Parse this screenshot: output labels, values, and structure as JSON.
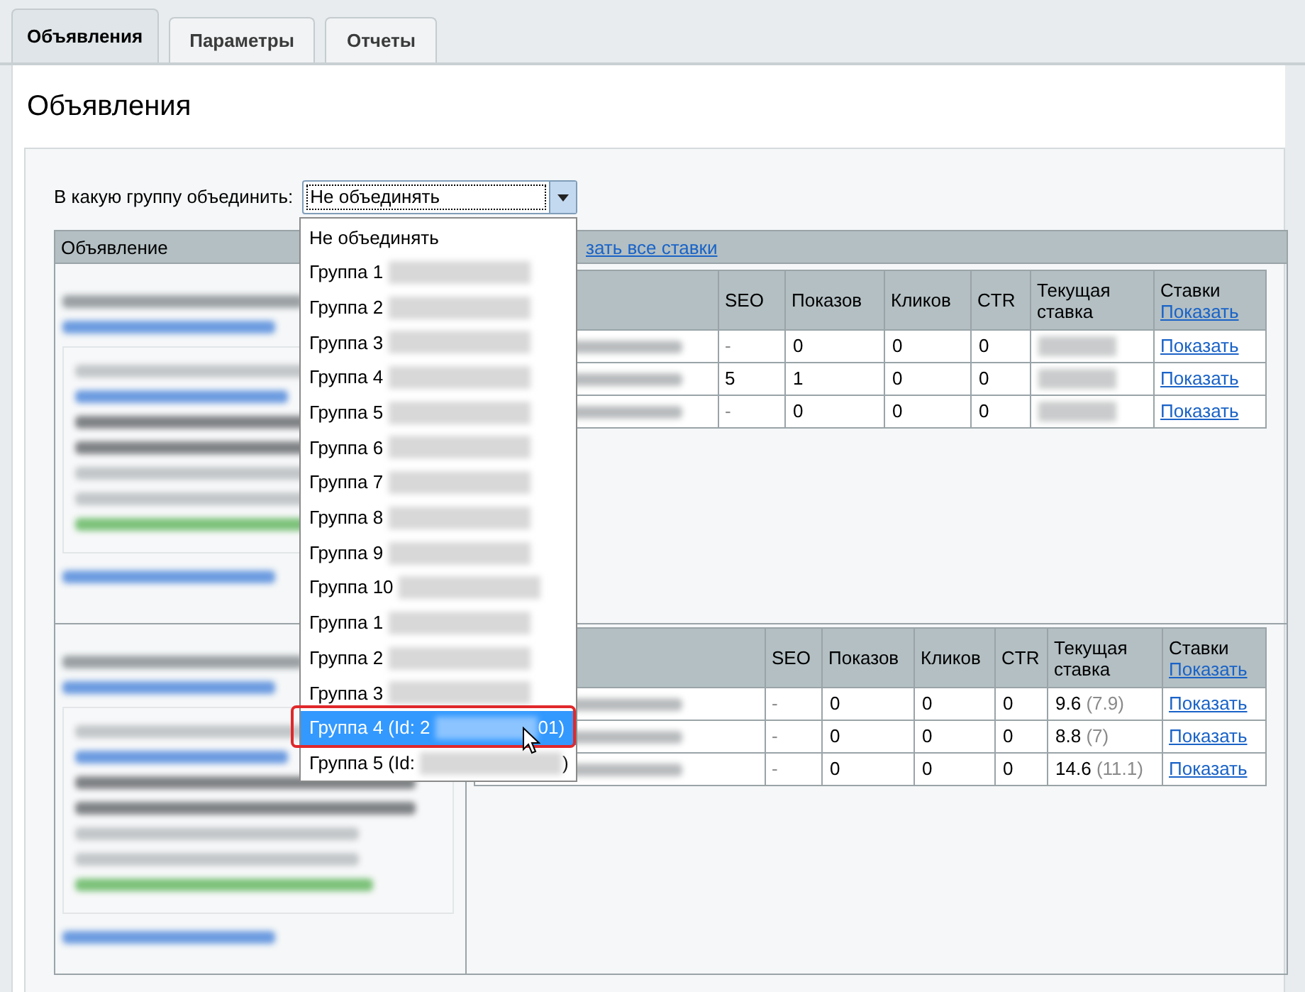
{
  "tabs": [
    {
      "label": "Объявления",
      "selected": true
    },
    {
      "label": "Параметры",
      "selected": false
    },
    {
      "label": "Отчеты",
      "selected": false
    }
  ],
  "heading": "Объявления",
  "merge": {
    "label": "В какую группу объединить:",
    "value": "Не объединять",
    "expanded": true
  },
  "dropdown": {
    "items": [
      {
        "label": "Не объединять",
        "blurred": false,
        "selected": false
      },
      {
        "label": "Группа 1",
        "blurred": true,
        "selected": false
      },
      {
        "label": "Группа 2",
        "blurred": true,
        "selected": false
      },
      {
        "label": "Группа 3",
        "blurred": true,
        "selected": false
      },
      {
        "label": "Группа 4",
        "blurred": true,
        "selected": false
      },
      {
        "label": "Группа 5",
        "blurred": true,
        "selected": false
      },
      {
        "label": "Группа 6",
        "blurred": true,
        "selected": false
      },
      {
        "label": "Группа 7",
        "blurred": true,
        "selected": false
      },
      {
        "label": "Группа 8",
        "blurred": true,
        "selected": false
      },
      {
        "label": "Группа 9",
        "blurred": true,
        "selected": false
      },
      {
        "label": "Группа 10",
        "blurred": true,
        "selected": false
      },
      {
        "label": "Группа 1",
        "blurred": true,
        "selected": false
      },
      {
        "label": "Группа 2",
        "blurred": true,
        "selected": false
      },
      {
        "label": "Группа 3",
        "blurred": true,
        "selected": false
      },
      {
        "label": "Группа 4 (Id: 2",
        "blurred": true,
        "after": "01)",
        "selected": true
      },
      {
        "label": "Группа 5 (Id:",
        "blurred": true,
        "after": ")",
        "selected": false
      }
    ]
  },
  "ads_table": {
    "column": "Объявление",
    "show_all_link": "зать все ставки",
    "ads": [
      {
        "lines": [
          {
            "kind": "title"
          },
          {
            "kind": "link"
          }
        ],
        "box_lines": [
          {
            "kind": "note"
          },
          {
            "kind": "link"
          },
          {
            "kind": "text"
          },
          {
            "kind": "text"
          },
          {
            "kind": "note"
          },
          {
            "kind": "note"
          },
          {
            "kind": "url"
          }
        ],
        "footer_lines": [
          {
            "kind": "link"
          }
        ],
        "columns": [
          "SEO",
          "Показов",
          "Кликов",
          "CTR",
          "Текущая ставка",
          "Ставки"
        ],
        "header_link": "Показать",
        "rows": [
          {
            "seo": "-",
            "seo_muted": true,
            "shows": "0",
            "clicks": "0",
            "ctr": "0",
            "bid_blurred": true,
            "link": "Показать"
          },
          {
            "seo": "5",
            "seo_muted": false,
            "shows": "1",
            "clicks": "0",
            "ctr": "0",
            "bid_blurred": true,
            "link": "Показать"
          },
          {
            "seo": "-",
            "seo_muted": true,
            "shows": "0",
            "clicks": "0",
            "ctr": "0",
            "bid_blurred": true,
            "link": "Показать"
          }
        ]
      },
      {
        "lines": [
          {
            "kind": "title"
          },
          {
            "kind": "link"
          }
        ],
        "box_lines": [
          {
            "kind": "note"
          },
          {
            "kind": "link"
          },
          {
            "kind": "text"
          },
          {
            "kind": "text"
          },
          {
            "kind": "note"
          },
          {
            "kind": "note"
          },
          {
            "kind": "url"
          }
        ],
        "footer_lines": [
          {
            "kind": "link"
          }
        ],
        "columns": [
          "SEO",
          "Показов",
          "Кликов",
          "CTR",
          "Текущая ставка",
          "Ставки"
        ],
        "header_link": "Показать",
        "rows": [
          {
            "seo": "-",
            "seo_muted": true,
            "shows": "0",
            "clicks": "0",
            "ctr": "0",
            "bid_blurred": false,
            "bid": "9.6",
            "bid_prev": "(7.9)",
            "link": "Показать"
          },
          {
            "seo": "-",
            "seo_muted": true,
            "shows": "0",
            "clicks": "0",
            "ctr": "0",
            "bid_blurred": false,
            "bid": "8.8",
            "bid_prev": "(7)",
            "link": "Показать"
          },
          {
            "seo": "-",
            "seo_muted": true,
            "shows": "0",
            "clicks": "0",
            "ctr": "0",
            "bid_blurred": false,
            "bid": "14.6",
            "bid_prev": "(11.1)",
            "link": "Показать"
          }
        ]
      }
    ]
  }
}
